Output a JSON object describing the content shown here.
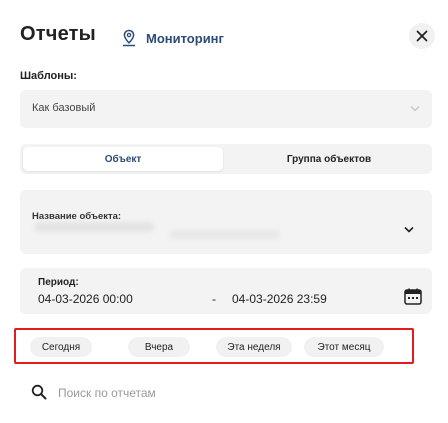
{
  "header": {
    "title": "Отчеты",
    "monitoring_label": "Мониторинг",
    "monitoring_icon": "location-pin-icon",
    "close_icon": "close-icon"
  },
  "templates": {
    "label": "Шаблоны:",
    "selected": "Как базовый"
  },
  "target_tabs": {
    "object": "Объект",
    "group": "Группа объектов",
    "active": "object"
  },
  "object_field": {
    "label": "Название объекта:"
  },
  "period": {
    "label": "Период:",
    "from": "04-03-2026 00:00",
    "separator": "-",
    "to": "04-03-2026 23:59"
  },
  "quick_ranges": [
    "Сегодня",
    "Вчера",
    "Эта неделя",
    "Этот месяц"
  ],
  "search": {
    "placeholder": "Поиск по отчетам",
    "value": ""
  },
  "colors": {
    "accent": "#2d4c7a",
    "highlight_border": "#e11d1d",
    "field_background": "#f3f3f3"
  }
}
